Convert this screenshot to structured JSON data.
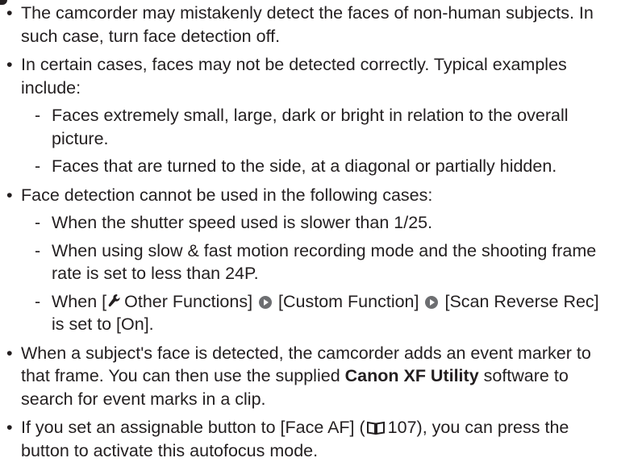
{
  "notes": {
    "bullet_char": "•",
    "dash_char": "-",
    "n1": "The camcorder may mistakenly detect the faces of non-human subjects. In such case, turn face detection off.",
    "n2": "In certain cases, faces may not be detected correctly. Typical examples include:",
    "n2_sub1": "Faces extremely small, large, dark or bright in relation to the overall picture.",
    "n2_sub2": "Faces that are turned to the side, at a diagonal or partially hidden.",
    "n3": "Face detection cannot be used in the following cases:",
    "n3_sub1": "When the shutter speed used is slower than 1/25.",
    "n3_sub2": "When using slow & fast motion recording mode and the shooting frame rate is set to less than 24P.",
    "n3_sub3": {
      "part1": "When [",
      "menu1": "Other Functions]",
      "menu2": "[Custom Function]",
      "menu3": "[Scan Reverse Rec] is set to [On]."
    },
    "n4": {
      "part1": "When a subject's face is detected, the camcorder adds an event marker to that frame. You can then use the supplied ",
      "bold": "Canon XF Utility",
      "part2": " software to search for event marks in a clip."
    },
    "n5": {
      "part1": "If you set an assignable button to [Face AF] (",
      "page_ref": "107",
      "part2": "), you can press the button to activate this autofocus mode."
    }
  },
  "icons": {
    "menu_arrow": "circle-arrow-icon",
    "other_functions": "wrench-icon",
    "page_reference": "book-icon"
  },
  "colors": {
    "text": "#231f20",
    "arrow_circle": "#6d6e71"
  }
}
